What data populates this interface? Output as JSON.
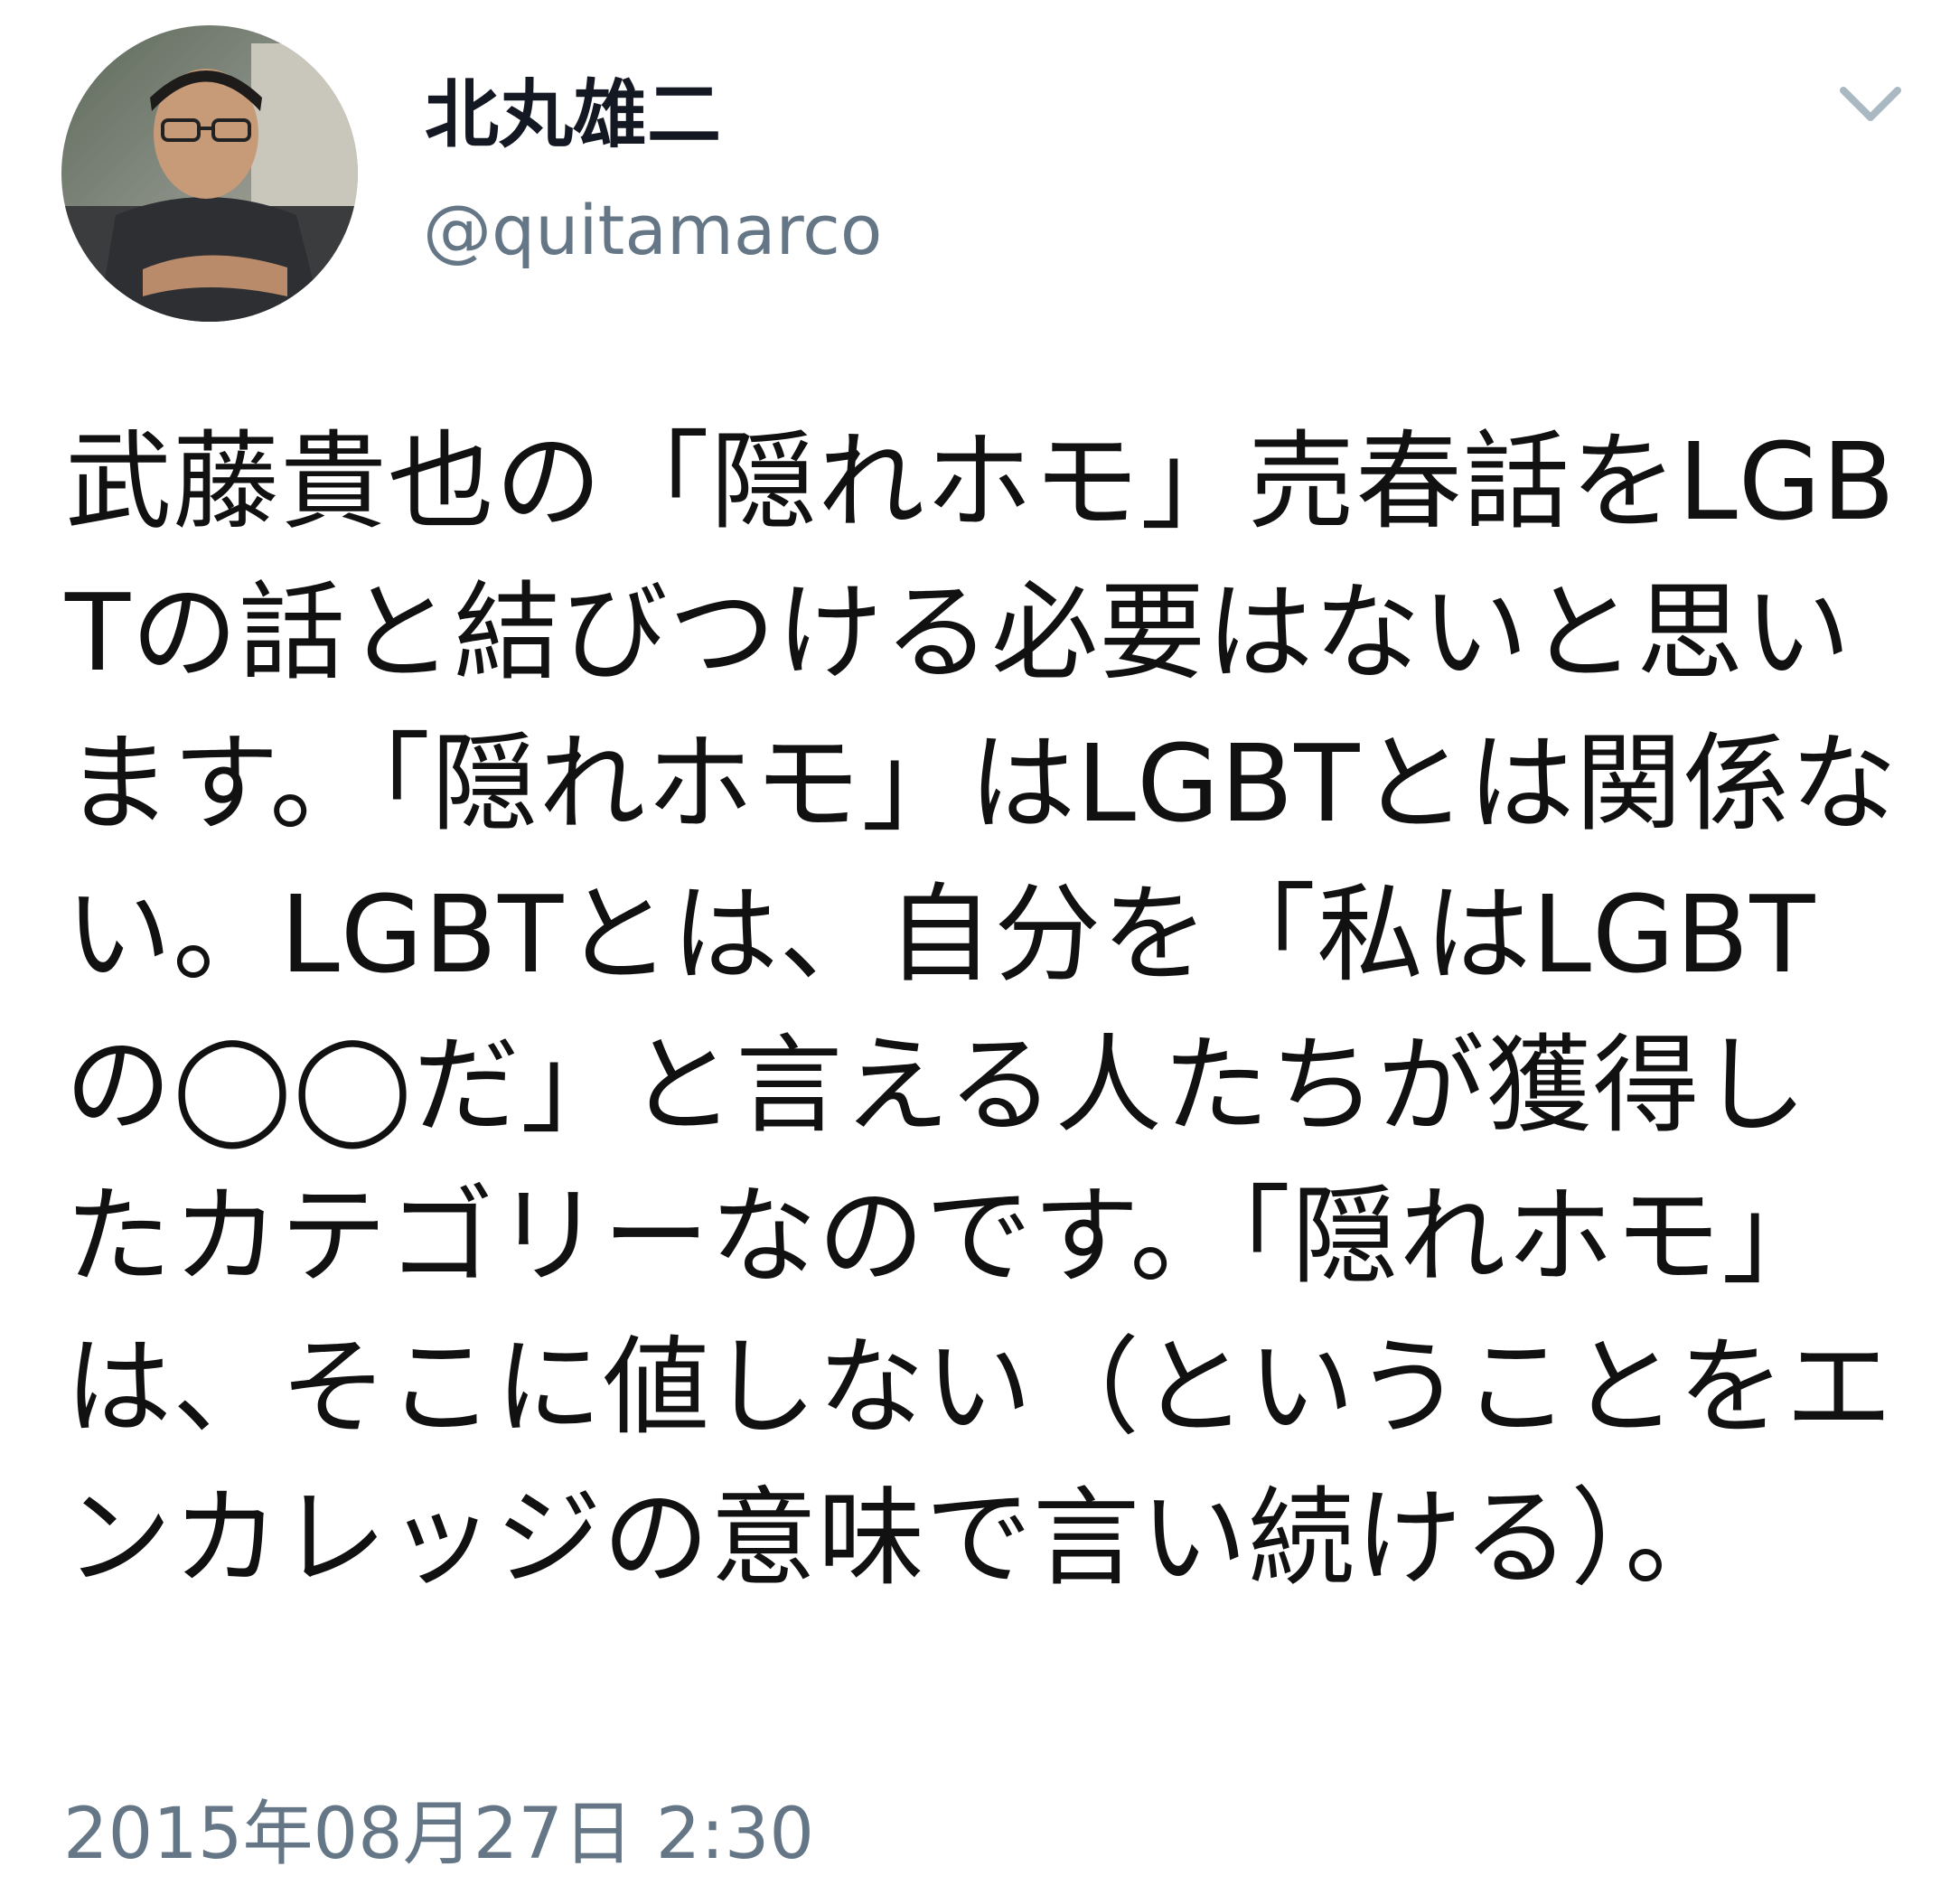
{
  "tweet": {
    "author": {
      "display_name": "北丸雄二",
      "handle": "@quitamarco",
      "avatar_icon": "user-avatar-photo"
    },
    "menu_icon": "chevron-down-icon",
    "text": "武藤貴也の「隠れホモ」売春話をLGBTの話と結びつける必要はないと思います。「隠れホモ」はLGBTとは関係ない。LGBTとは、自分を「私はLGBTの◯◯だ」と言える人たちが獲得したカテゴリーなのです。「隠れホモ」は、そこに値しない（ということをエンカレッジの意味で言い続ける）。",
    "timestamp": "2015年08月27日 2:30"
  },
  "colors": {
    "text_primary": "#141823",
    "text_secondary": "#657786",
    "chevron": "#AAB8C2",
    "background": "#FFFFFF"
  }
}
